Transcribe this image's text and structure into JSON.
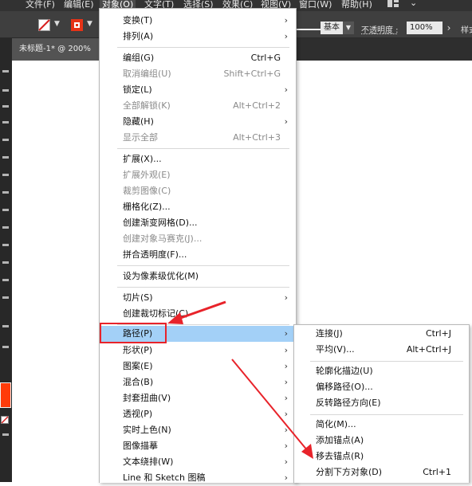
{
  "menubar": {
    "items": [
      {
        "label": "文件(F)"
      },
      {
        "label": "编辑(E)"
      },
      {
        "label": "对象(O)",
        "active": true
      },
      {
        "label": "文字(T)"
      },
      {
        "label": "选择(S)"
      },
      {
        "label": "效果(C)"
      },
      {
        "label": "视图(V)"
      },
      {
        "label": "窗口(W)"
      },
      {
        "label": "帮助(H)"
      }
    ],
    "workspace_icon": "grid-icon",
    "workspace_chevron": "⌄"
  },
  "controlbar": {
    "stroke_profile": "基本",
    "opacity_label": "不透明度 :",
    "opacity_value": "100%",
    "style_label": "样式",
    "arrow_left": "⌄",
    "arrow_right": "›",
    "fill_color": "#ff3b0a",
    "stroke_none_color": "#d62020"
  },
  "document": {
    "tab_title": "未标题-1* @ 200%"
  },
  "object_menu": {
    "items": [
      {
        "label": "变换(T)",
        "submenu": true
      },
      {
        "label": "排列(A)",
        "submenu": true
      },
      {
        "separator": true
      },
      {
        "label": "编组(G)",
        "shortcut": "Ctrl+G"
      },
      {
        "label": "取消编组(U)",
        "shortcut": "Shift+Ctrl+G",
        "disabled": true
      },
      {
        "label": "锁定(L)",
        "submenu": true
      },
      {
        "label": "全部解锁(K)",
        "shortcut": "Alt+Ctrl+2",
        "disabled": true
      },
      {
        "label": "隐藏(H)",
        "submenu": true
      },
      {
        "label": "显示全部",
        "shortcut": "Alt+Ctrl+3",
        "disabled": true
      },
      {
        "separator": true
      },
      {
        "label": "扩展(X)..."
      },
      {
        "label": "扩展外观(E)",
        "disabled": true
      },
      {
        "label": "裁剪图像(C)",
        "disabled": true
      },
      {
        "label": "栅格化(Z)..."
      },
      {
        "label": "创建渐变网格(D)..."
      },
      {
        "label": "创建对象马赛克(J)...",
        "disabled": true
      },
      {
        "label": "拼合透明度(F)..."
      },
      {
        "separator": true
      },
      {
        "label": "设为像素级优化(M)"
      },
      {
        "separator": true
      },
      {
        "label": "切片(S)",
        "submenu": true
      },
      {
        "label": "创建裁切标记(C)"
      },
      {
        "separator": true
      },
      {
        "label": "路径(P)",
        "submenu": true,
        "highlighted": true
      },
      {
        "label": "形状(P)",
        "submenu": true
      },
      {
        "label": "图案(E)",
        "submenu": true
      },
      {
        "label": "混合(B)",
        "submenu": true
      },
      {
        "label": "封套扭曲(V)",
        "submenu": true
      },
      {
        "label": "透视(P)",
        "submenu": true
      },
      {
        "label": "实时上色(N)",
        "submenu": true
      },
      {
        "label": "图像描摹",
        "submenu": true
      },
      {
        "label": "文本绕排(W)",
        "submenu": true
      },
      {
        "label": "Line 和 Sketch 图稿",
        "submenu": true
      }
    ],
    "submenu_arrow": "›"
  },
  "path_menu": {
    "items": [
      {
        "label": "连接(J)",
        "shortcut": "Ctrl+J"
      },
      {
        "label": "平均(V)...",
        "shortcut": "Alt+Ctrl+J"
      },
      {
        "separator": true
      },
      {
        "label": "轮廓化描边(U)"
      },
      {
        "label": "偏移路径(O)..."
      },
      {
        "label": "反转路径方向(E)"
      },
      {
        "separator": true
      },
      {
        "label": "简化(M)..."
      },
      {
        "label": "添加锚点(A)"
      },
      {
        "label": "移去锚点(R)"
      },
      {
        "label": "分割下方对象(D)",
        "shortcut": "Ctrl+1"
      }
    ]
  },
  "annotation": {
    "color": "#e8232a"
  }
}
